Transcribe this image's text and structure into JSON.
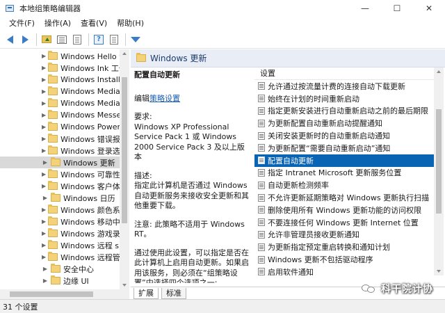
{
  "window": {
    "title": "本地组策略编辑器",
    "min_glyph": "—",
    "max_glyph": "☐",
    "close_glyph": "✕"
  },
  "menu": [
    "文件(F)",
    "操作(A)",
    "查看(V)",
    "帮助(H)"
  ],
  "toolbar": {
    "icons": [
      "back-arrow-icon",
      "forward-arrow-icon",
      "up-folder-icon",
      "show-hide-tree-icon",
      "help-icon",
      "properties-icon",
      "filter-icon"
    ],
    "help_glyph": "?"
  },
  "tree": {
    "items": [
      {
        "label": "Windows Hello 企",
        "selected": false
      },
      {
        "label": "Windows Ink 工作",
        "selected": false
      },
      {
        "label": "Windows Installe",
        "selected": false
      },
      {
        "label": "Windows Media",
        "selected": false
      },
      {
        "label": "Windows Media",
        "selected": false
      },
      {
        "label": "Windows Messe",
        "selected": false
      },
      {
        "label": "Windows PowerS",
        "selected": false
      },
      {
        "label": "Windows 错误报",
        "selected": false
      },
      {
        "label": "Windows 登录选",
        "selected": false
      },
      {
        "label": "Windows 更新",
        "selected": true
      },
      {
        "label": "Windows 可靠性",
        "selected": false
      },
      {
        "label": "Windows 客户体",
        "selected": false
      },
      {
        "label": "Windows 日历",
        "selected": false
      },
      {
        "label": "Windows 颜色系",
        "selected": false
      },
      {
        "label": "Windows 移动中",
        "selected": false
      },
      {
        "label": "Windows 游戏录",
        "selected": false
      },
      {
        "label": "Windows 远程 sh",
        "selected": false
      },
      {
        "label": "Windows 远程管",
        "selected": false
      },
      {
        "label": "安全中心",
        "selected": false
      },
      {
        "label": "边缘 UI",
        "selected": false
      }
    ],
    "expander_glyph": "▶"
  },
  "right_pane": {
    "header_title": "Windows 更新",
    "description": {
      "title": "配置自动更新",
      "edit_prefix": "编辑",
      "edit_link": "策略设置",
      "requirements": "要求:\nWindows XP Professional Service Pack 1 或 Windows 2000 Service Pack 3 及以上版本",
      "summary": "描述:\n指定此计算机是否通过 Windows 自动更新服务来接收安全更新和其他重要下载。",
      "note": "注意: 此策略不适用于 Windows RT。",
      "more": "通过使用此设置，可以指定是否在此计算机上启用自动更新。如果启用该服务，则必须在“组策略设置”中选择四个选项之一:"
    },
    "settings_header": "设置",
    "settings": [
      {
        "label": "允许通过按流量计费的连接自动下载更新",
        "selected": false
      },
      {
        "label": "始终在计划的时间重新启动",
        "selected": false
      },
      {
        "label": "指定更新安装进行自动重新启动之前的最后期限",
        "selected": false
      },
      {
        "label": "为更新配置自动重新启动提醒通知",
        "selected": false
      },
      {
        "label": "关闭安装更新时的自动重新启动通知",
        "selected": false
      },
      {
        "label": "为更新配置“需要自动重新启动”通知",
        "selected": false
      },
      {
        "label": "配置自动更新",
        "selected": true
      },
      {
        "label": "指定 Intranet Microsoft 更新服务位置",
        "selected": false
      },
      {
        "label": "自动更新检测频率",
        "selected": false
      },
      {
        "label": "不允许更新延期策略对 Windows 更新执行扫描",
        "selected": false
      },
      {
        "label": "删除使用所有 Windows 更新功能的访问权限",
        "selected": false
      },
      {
        "label": "不要连接任何 Windows 更新 Internet 位置",
        "selected": false
      },
      {
        "label": "允许非管理员接收更新通知",
        "selected": false
      },
      {
        "label": "为更新指定预定重启转换和通知计划",
        "selected": false
      },
      {
        "label": "Windows 更新不包括驱动程序",
        "selected": false
      },
      {
        "label": "启用软件通知",
        "selected": false
      }
    ]
  },
  "tabs": [
    {
      "label": "扩展",
      "active": true
    },
    {
      "label": "标准",
      "active": false
    }
  ],
  "watermark": {
    "text": "科干院计协"
  },
  "statusbar": {
    "text": "31 个设置"
  },
  "colors": {
    "selection": "#0a64b4",
    "link": "#1a5fb4",
    "tree_selected": "#d9d9d9"
  }
}
